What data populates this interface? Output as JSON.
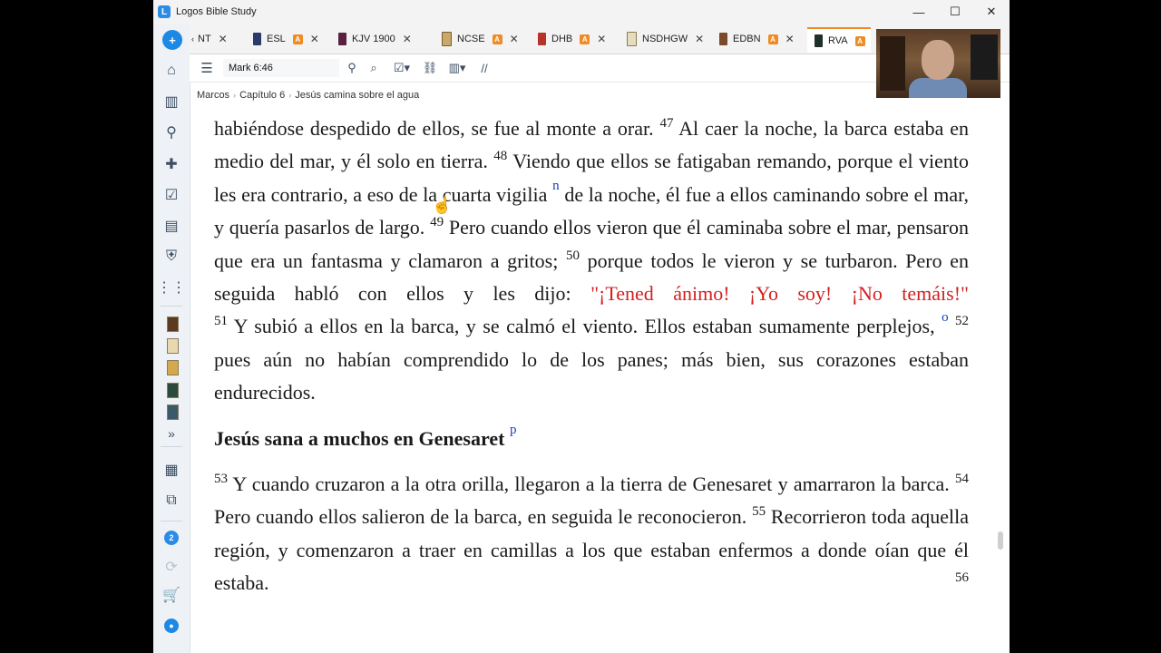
{
  "window": {
    "title": "Logos Bible Study",
    "minimize": "—",
    "maximize": "☐",
    "close": "✕"
  },
  "tabs": [
    {
      "label": "NT",
      "badge": "",
      "close": "✕"
    },
    {
      "label": "ESL",
      "badge": "A",
      "close": "✕"
    },
    {
      "label": "KJV 1900",
      "badge": "",
      "close": "✕"
    },
    {
      "label": "NCSE",
      "badge": "A",
      "close": "✕"
    },
    {
      "label": "DHB",
      "badge": "A",
      "close": "✕"
    },
    {
      "label": "NSDHGW",
      "badge": "",
      "close": "✕"
    },
    {
      "label": "EDBN",
      "badge": "A",
      "close": "✕"
    },
    {
      "label": "RVA",
      "badge": "A",
      "close": ""
    }
  ],
  "toolbar": {
    "reference": "Mark 6:46"
  },
  "breadcrumb": [
    "Marcos",
    "Capítulo 6",
    "Jesús camina sobre el agua"
  ],
  "rail": {
    "badge_count": "2",
    "more": "»"
  },
  "passage": {
    "p1_a": "habiéndose despedido de ellos, se fue al monte a orar.",
    "v47": "47",
    "p1_b": "Al caer la noche, la barca estaba en medio del mar, y él solo en tierra.",
    "v48": "48",
    "p1_c": "Viendo que ellos se fatigaban remando, porque el viento les era contrario, a eso de la cuarta vigilia",
    "fn_n": "n",
    "p1_d": "de la noche, él fue a ellos caminando sobre el mar, y quería pasarlos de largo.",
    "v49": "49",
    "p1_e": "Pero cuando ellos vieron que él caminaba sobre el mar, pensaron que era un fantasma y clamaron a gritos;",
    "v50": "50",
    "p1_f": "porque todos le vieron y se turbaron. Pero en seguida habló con ellos y les dijo:",
    "red_1": "\"¡Tened ánimo! ¡Yo soy! ¡No temáis!\"",
    "v51": "51",
    "p2_a": "Y subió a ellos en la barca, y se calmó el viento. Ellos estaban sumamente perplejos,",
    "fn_o": "o",
    "v52": "52",
    "p2_b": "pues aún no habían comprendido lo de los panes; más bien, sus corazones estaban endurecidos.",
    "heading": "Jesús sana a muchos en Genesaret",
    "fn_p": "p",
    "v53": "53",
    "p3_a": "Y cuando cruzaron a la otra orilla, llegaron a la tierra de Genesaret y amarraron la barca.",
    "v54": "54",
    "p3_b": "Pero cuando ellos salieron de la barca, en seguida le reconocieron.",
    "v55": "55",
    "p3_c": "Recorrieron toda aquella región, y comenzaron a traer en camillas a los que estaban enfermos a donde oían que él estaba.",
    "v56": "56"
  },
  "colors": {
    "accent": "#f08a24",
    "brand": "#2b8be6",
    "jesus_words": "#d21f1f",
    "footnote": "#1a3fb5"
  }
}
